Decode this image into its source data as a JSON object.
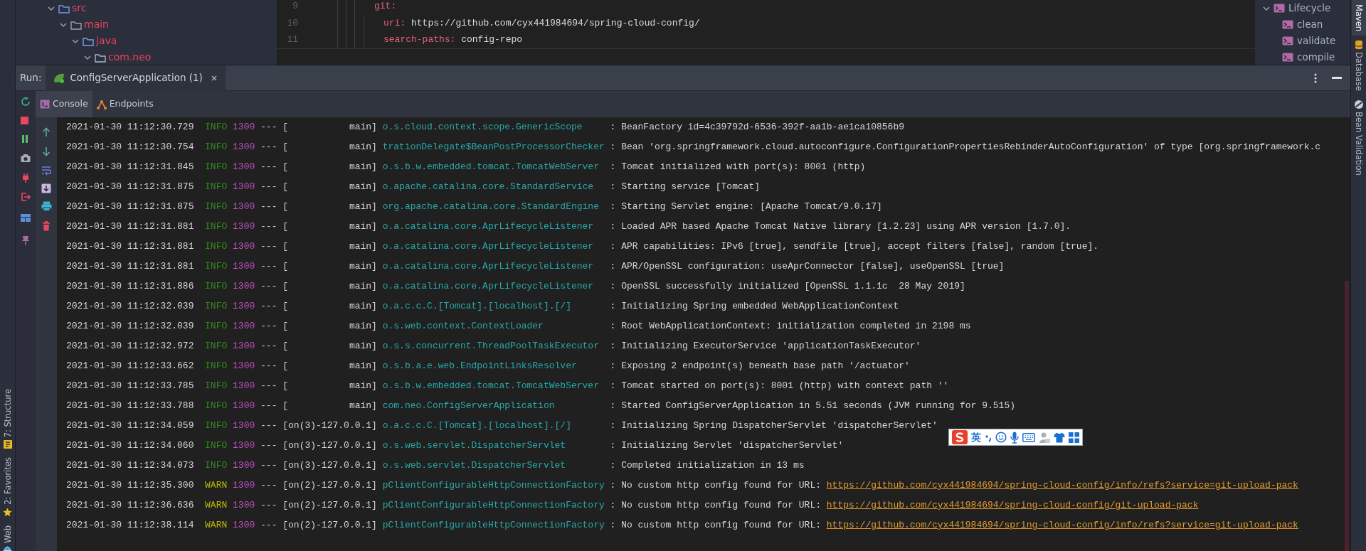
{
  "project_tree": [
    {
      "label": "src",
      "expanded": true,
      "children": [
        {
          "label": "main",
          "expanded": true,
          "children": [
            {
              "label": "java",
              "expanded": true,
              "children": [
                {
                  "label": "com.neo",
                  "expanded": true
                }
              ]
            }
          ]
        }
      ]
    }
  ],
  "editor": {
    "lines": [
      {
        "number": "9",
        "key": "git:",
        "children": [
          {
            "number": "10",
            "key": "uri:",
            "value": "https://github.com/cyx441984694/spring-cloud-config/"
          },
          {
            "number": "11",
            "key": "search-paths:",
            "value": "config-repo"
          }
        ]
      }
    ]
  },
  "maven": [
    {
      "label": "Lifecycle",
      "expanded": true,
      "children": [
        {
          "label": "clean"
        },
        {
          "label": "validate"
        },
        {
          "label": "compile"
        }
      ]
    }
  ],
  "right_stripe": [
    {
      "label": "Maven",
      "selected": true,
      "kind": "plain"
    },
    {
      "label": "Database",
      "selected": false,
      "kind": "database"
    },
    {
      "label": "Bean Validation",
      "selected": false,
      "kind": "bean"
    }
  ],
  "left_stripe": [
    {
      "label": "7: Structure",
      "kind": "structure"
    },
    {
      "label": "2: Favorites",
      "kind": "favorites"
    },
    {
      "label": "Web",
      "kind": "web"
    }
  ],
  "run_bar": {
    "label": "Run:",
    "tabs": [
      {
        "label": "ConfigServerApplication (1)",
        "selected": true
      }
    ]
  },
  "console_tabs": [
    {
      "label": "Console",
      "selected": true,
      "kind": "console"
    },
    {
      "label": "Endpoints",
      "selected": false,
      "kind": "endpoints"
    }
  ],
  "log": [
    {
      "time": "2021-01-30 11:12:30.729",
      "level": "INFO",
      "pid": "1300",
      "sep": "---",
      "thread": "[           main]",
      "logger": "o.s.cloud.context.scope.GenericScope",
      "message": ": BeanFactory id=4c39792d-6536-392f-aa1b-ae1ca10856b9"
    },
    {
      "time": "2021-01-30 11:12:30.754",
      "level": "INFO",
      "pid": "1300",
      "sep": "---",
      "thread": "[           main]",
      "logger": "trationDelegate$BeanPostProcessorChecker",
      "message": ": Bean 'org.springframework.cloud.autoconfigure.ConfigurationPropertiesRebinderAutoConfiguration' of type [org.springframework.c"
    },
    {
      "time": "2021-01-30 11:12:31.845",
      "level": "INFO",
      "pid": "1300",
      "sep": "---",
      "thread": "[           main]",
      "logger": "o.s.b.w.embedded.tomcat.TomcatWebServer",
      "message": ": Tomcat initialized with port(s): 8001 (http)"
    },
    {
      "time": "2021-01-30 11:12:31.875",
      "level": "INFO",
      "pid": "1300",
      "sep": "---",
      "thread": "[           main]",
      "logger": "o.apache.catalina.core.StandardService",
      "message": ": Starting service [Tomcat]"
    },
    {
      "time": "2021-01-30 11:12:31.875",
      "level": "INFO",
      "pid": "1300",
      "sep": "---",
      "thread": "[           main]",
      "logger": "org.apache.catalina.core.StandardEngine",
      "message": ": Starting Servlet engine: [Apache Tomcat/9.0.17]"
    },
    {
      "time": "2021-01-30 11:12:31.881",
      "level": "INFO",
      "pid": "1300",
      "sep": "---",
      "thread": "[           main]",
      "logger": "o.a.catalina.core.AprLifecycleListener",
      "message": ": Loaded APR based Apache Tomcat Native library [1.2.23] using APR version [1.7.0]."
    },
    {
      "time": "2021-01-30 11:12:31.881",
      "level": "INFO",
      "pid": "1300",
      "sep": "---",
      "thread": "[           main]",
      "logger": "o.a.catalina.core.AprLifecycleListener",
      "message": ": APR capabilities: IPv6 [true], sendfile [true], accept filters [false], random [true]."
    },
    {
      "time": "2021-01-30 11:12:31.881",
      "level": "INFO",
      "pid": "1300",
      "sep": "---",
      "thread": "[           main]",
      "logger": "o.a.catalina.core.AprLifecycleListener",
      "message": ": APR/OpenSSL configuration: useAprConnector [false], useOpenSSL [true]"
    },
    {
      "time": "2021-01-30 11:12:31.886",
      "level": "INFO",
      "pid": "1300",
      "sep": "---",
      "thread": "[           main]",
      "logger": "o.a.catalina.core.AprLifecycleListener",
      "message": ": OpenSSL successfully initialized [OpenSSL 1.1.1c  28 May 2019]"
    },
    {
      "time": "2021-01-30 11:12:32.039",
      "level": "INFO",
      "pid": "1300",
      "sep": "---",
      "thread": "[           main]",
      "logger": "o.a.c.c.C.[Tomcat].[localhost].[/]",
      "message": ": Initializing Spring embedded WebApplicationContext"
    },
    {
      "time": "2021-01-30 11:12:32.039",
      "level": "INFO",
      "pid": "1300",
      "sep": "---",
      "thread": "[           main]",
      "logger": "o.s.web.context.ContextLoader",
      "message": ": Root WebApplicationContext: initialization completed in 2198 ms"
    },
    {
      "time": "2021-01-30 11:12:32.972",
      "level": "INFO",
      "pid": "1300",
      "sep": "---",
      "thread": "[           main]",
      "logger": "o.s.s.concurrent.ThreadPoolTaskExecutor",
      "message": ": Initializing ExecutorService 'applicationTaskExecutor'"
    },
    {
      "time": "2021-01-30 11:12:33.662",
      "level": "INFO",
      "pid": "1300",
      "sep": "---",
      "thread": "[           main]",
      "logger": "o.s.b.a.e.web.EndpointLinksResolver",
      "message": ": Exposing 2 endpoint(s) beneath base path '/actuator'"
    },
    {
      "time": "2021-01-30 11:12:33.785",
      "level": "INFO",
      "pid": "1300",
      "sep": "---",
      "thread": "[           main]",
      "logger": "o.s.b.w.embedded.tomcat.TomcatWebServer",
      "message": ": Tomcat started on port(s): 8001 (http) with context path ''"
    },
    {
      "time": "2021-01-30 11:12:33.788",
      "level": "INFO",
      "pid": "1300",
      "sep": "---",
      "thread": "[           main]",
      "logger": "com.neo.ConfigServerApplication",
      "message": ": Started ConfigServerApplication in 5.51 seconds (JVM running for 9.515)"
    },
    {
      "time": "2021-01-30 11:12:34.059",
      "level": "INFO",
      "pid": "1300",
      "sep": "---",
      "thread": "[on(3)-127.0.0.1]",
      "logger": "o.a.c.c.C.[Tomcat].[localhost].[/]",
      "message": ": Initializing Spring DispatcherServlet 'dispatcherServlet'"
    },
    {
      "time": "2021-01-30 11:12:34.060",
      "level": "INFO",
      "pid": "1300",
      "sep": "---",
      "thread": "[on(3)-127.0.0.1]",
      "logger": "o.s.web.servlet.DispatcherServlet",
      "message": ": Initializing Servlet 'dispatcherServlet'"
    },
    {
      "time": "2021-01-30 11:12:34.073",
      "level": "INFO",
      "pid": "1300",
      "sep": "---",
      "thread": "[on(3)-127.0.0.1]",
      "logger": "o.s.web.servlet.DispatcherServlet",
      "message": ": Completed initialization in 13 ms"
    },
    {
      "time": "2021-01-30 11:12:35.300",
      "level": "WARN",
      "pid": "1300",
      "sep": "---",
      "thread": "[on(2)-127.0.0.1]",
      "logger": "pClientConfigurableHttpConnectionFactory",
      "message": ": No custom http config found for URL:",
      "link": "https://github.com/cyx441984694/spring-cloud-config/info/refs?service=git-upload-pack"
    },
    {
      "time": "2021-01-30 11:12:36.636",
      "level": "WARN",
      "pid": "1300",
      "sep": "---",
      "thread": "[on(2)-127.0.0.1]",
      "logger": "pClientConfigurableHttpConnectionFactory",
      "message": ": No custom http config found for URL:",
      "link": "https://github.com/cyx441984694/spring-cloud-config/git-upload-pack"
    },
    {
      "time": "2021-01-30 11:12:38.114",
      "level": "WARN",
      "pid": "1300",
      "sep": "---",
      "thread": "[on(2)-127.0.0.1]",
      "logger": "pClientConfigurableHttpConnectionFactory",
      "message": ": No custom http config found for URL:",
      "link": "https://github.com/cyx441984694/spring-cloud-config/info/refs?service=git-upload-pack"
    }
  ],
  "ime_toolbar": {
    "language": "英"
  }
}
